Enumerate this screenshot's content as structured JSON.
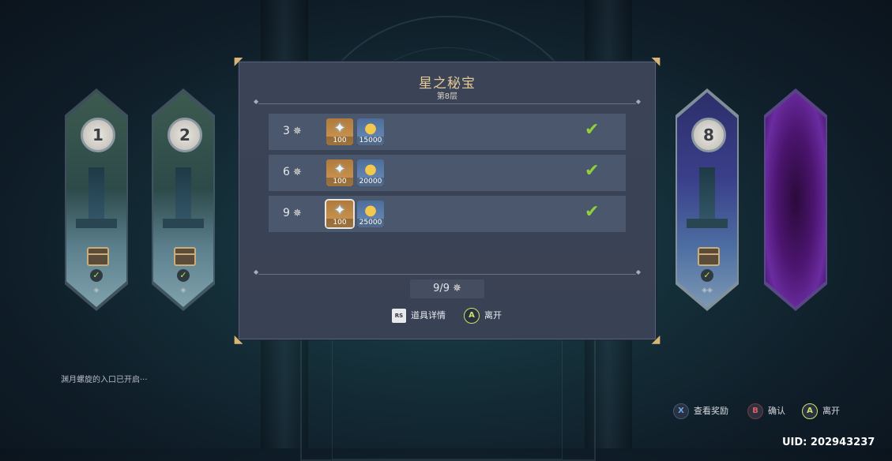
{
  "floors": [
    {
      "number": "1",
      "status": "cleared",
      "check": "✓",
      "dots": "◈"
    },
    {
      "number": "2",
      "status": "cleared",
      "check": "✓",
      "dots": "◈"
    },
    {
      "number": "8",
      "status": "selected",
      "check": "✓",
      "dots": "◈◈"
    },
    {
      "number": "",
      "status": "locked"
    }
  ],
  "panel": {
    "title": "星之秘宝",
    "subtitle": "第8层",
    "rewards": [
      {
        "stars": "3",
        "items": [
          {
            "type": "primogem",
            "count": "100"
          },
          {
            "type": "mora",
            "count": "15000"
          }
        ],
        "claimed": "✔"
      },
      {
        "stars": "6",
        "items": [
          {
            "type": "primogem",
            "count": "100"
          },
          {
            "type": "mora",
            "count": "20000"
          }
        ],
        "claimed": "✔"
      },
      {
        "stars": "9",
        "items": [
          {
            "type": "primogem",
            "count": "100"
          },
          {
            "type": "mora",
            "count": "25000"
          }
        ],
        "claimed": "✔"
      }
    ],
    "star_total": "9/9",
    "actions": {
      "details_button": "RS",
      "details_label": "道具详情",
      "leave_button": "A",
      "leave_label": "离开"
    }
  },
  "status_message": "渊月螺旋的入口已开启···",
  "hints": {
    "x_button": "X",
    "x_label": "查看奖励",
    "b_button": "B",
    "b_label": "确认",
    "a_button": "A",
    "a_label": "离开"
  },
  "uid": "UID: 202943237",
  "colors": {
    "title_gold": "#e4c996",
    "check_green": "#8fd13a",
    "panel_bg": "#3b4456"
  }
}
